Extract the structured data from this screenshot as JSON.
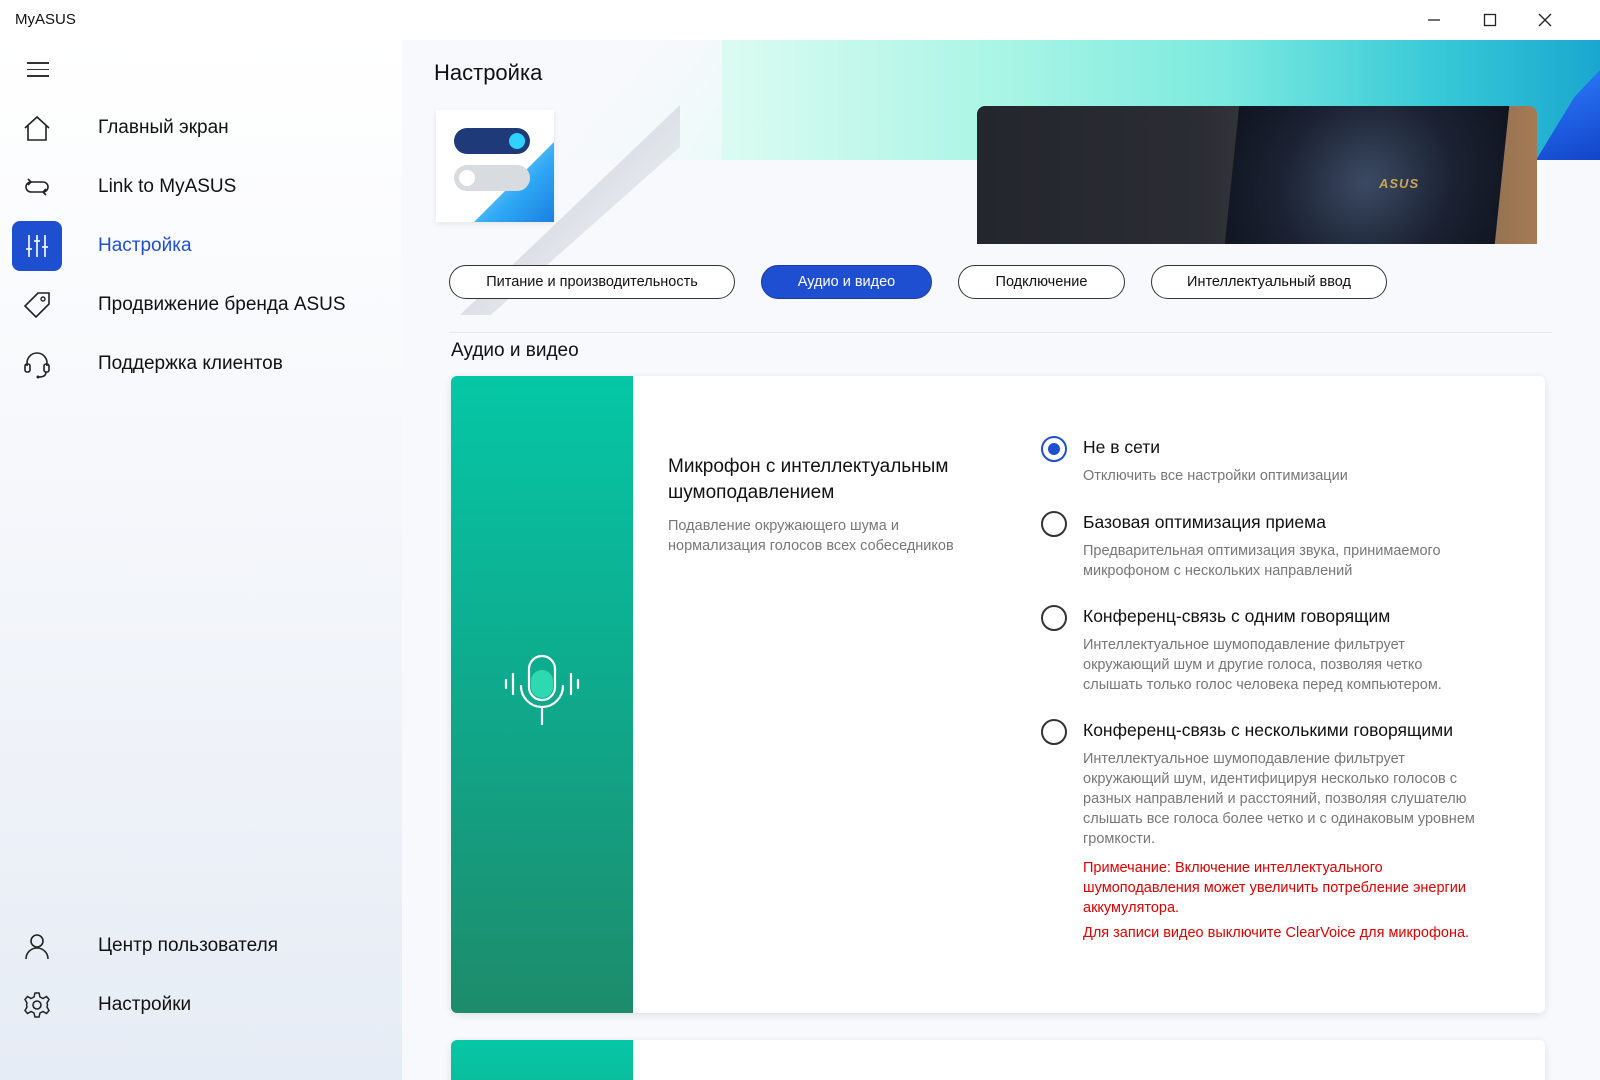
{
  "window": {
    "title": "MyASUS",
    "controls": [
      "minimize",
      "maximize",
      "close"
    ]
  },
  "sidebar": {
    "menu_icon": "hamburger-icon",
    "items": [
      {
        "label": "Главный экран",
        "icon": "home-icon",
        "active": false
      },
      {
        "label": "Link to MyASUS",
        "icon": "link-icon",
        "active": false
      },
      {
        "label": "Настройка",
        "icon": "sliders-icon",
        "active": true
      },
      {
        "label": "Продвижение бренда ASUS",
        "icon": "tag-icon",
        "active": false
      },
      {
        "label": "Поддержка клиентов",
        "icon": "headset-icon",
        "active": false
      }
    ],
    "bottom_items": [
      {
        "label": "Центр пользователя",
        "icon": "user-icon"
      },
      {
        "label": "Настройки",
        "icon": "gear-icon"
      }
    ]
  },
  "header": {
    "page_title": "Настройка",
    "laptop_logo": "ASUS"
  },
  "tabs": [
    {
      "label": "Питание и производительность",
      "active": false
    },
    {
      "label": "Аудио и видео",
      "active": true
    },
    {
      "label": "Подключение",
      "active": false
    },
    {
      "label": "Интеллектуальный ввод",
      "active": false
    }
  ],
  "section": {
    "title": "Аудио и видео"
  },
  "feature": {
    "icon": "microphone-icon",
    "title": "Микрофон с интеллектуальным шумоподавлением",
    "description": "Подавление окружающего шума и нормализация голосов всех собеседников",
    "options": [
      {
        "label": "Не в сети",
        "description": "Отключить все настройки оптимизации",
        "selected": true
      },
      {
        "label": "Базовая оптимизация приема",
        "description": "Предварительная оптимизация звука, принимаемого микрофоном с нескольких направлений",
        "selected": false
      },
      {
        "label": "Конференц-связь с одним говорящим",
        "description": "Интеллектуальное шумоподавление фильтрует окружающий шум и другие голоса, позволяя четко слышать только голос человека перед компьютером.",
        "selected": false
      },
      {
        "label": "Конференц-связь с несколькими говорящими",
        "description": "Интеллектуальное шумоподавление фильтрует окружающий шум, идентифицируя несколько голосов с разных направлений и расстояний, позволяя слушателю слышать все голоса более четко и с одинаковым уровнем громкости.",
        "selected": false
      }
    ],
    "notes": [
      "Примечание: Включение интеллектуального шумоподавления может увеличить потребление энергии аккумулятора.",
      "Для записи видео выключите ClearVoice для микрофона."
    ]
  },
  "colors": {
    "accent": "#1f4fd1",
    "feature_panel": "#0fa98c",
    "note": "#e00000"
  }
}
